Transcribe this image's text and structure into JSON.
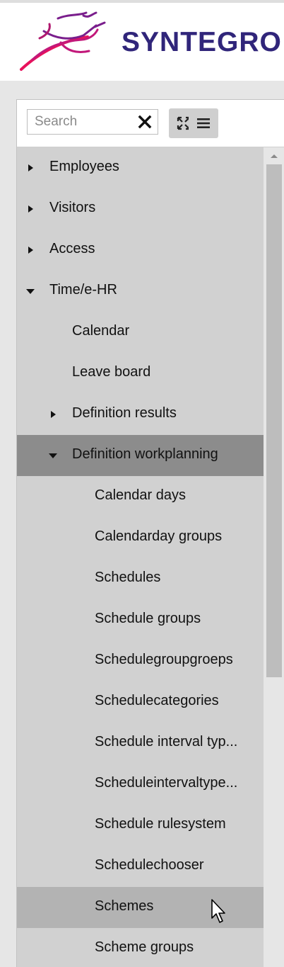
{
  "brand": {
    "name": "SYNTEGRO",
    "accent": "#30257a",
    "logo_colors": [
      "#e8125c",
      "#7a1e8c",
      "#30257a"
    ]
  },
  "toolbar": {
    "search_placeholder": "Search",
    "clear_icon": "close-icon",
    "expand_icon": "expand-icon",
    "menu_icon": "hamburger-menu-icon"
  },
  "tree": {
    "items": [
      {
        "label": "Employees",
        "state": "collapsed"
      },
      {
        "label": "Visitors",
        "state": "collapsed"
      },
      {
        "label": "Access",
        "state": "collapsed"
      },
      {
        "label": "Time/e-HR",
        "state": "expanded"
      },
      {
        "label": "Calendar",
        "state": "leaf"
      },
      {
        "label": "Leave board",
        "state": "leaf"
      },
      {
        "label": "Definition results",
        "state": "collapsed"
      },
      {
        "label": "Definition workplanning",
        "state": "expanded",
        "selected": true
      },
      {
        "label": "Calendar days",
        "state": "leaf"
      },
      {
        "label": "Calendarday groups",
        "state": "leaf"
      },
      {
        "label": "Schedules",
        "state": "leaf"
      },
      {
        "label": "Schedule groups",
        "state": "leaf"
      },
      {
        "label": "Schedulegroupgroeps",
        "state": "leaf"
      },
      {
        "label": "Schedulecategories",
        "state": "leaf"
      },
      {
        "label": "Schedule interval typ...",
        "state": "leaf"
      },
      {
        "label": "Scheduleintervaltype...",
        "state": "leaf"
      },
      {
        "label": "Schedule rulesystem",
        "state": "leaf"
      },
      {
        "label": "Schedulechooser",
        "state": "leaf"
      },
      {
        "label": "Schemes",
        "state": "leaf",
        "hovered": true
      },
      {
        "label": "Scheme groups",
        "state": "leaf"
      }
    ]
  }
}
